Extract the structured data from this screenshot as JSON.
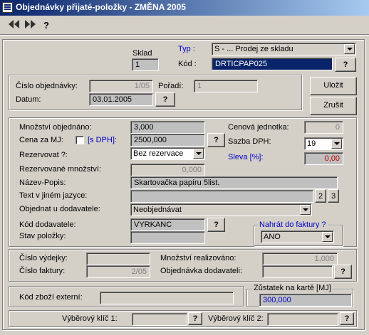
{
  "window": {
    "title": "Objednávky přijaté-položky - ZMĚNA 2005"
  },
  "toolbar": {
    "first_icon": "rewind-icon",
    "last_icon": "fast-forward-icon",
    "help_label": "?"
  },
  "top": {
    "sklad_label": "Sklad",
    "sklad_value": "1",
    "typ_label": "Typ :",
    "typ_value": "S - ...   Prodej ze skladu",
    "kod_label": "Kód :",
    "kod_value": "DRTICPAP025",
    "help": "?"
  },
  "order": {
    "cislo_label": "Číslo objednávky:",
    "cislo_value": "1/05",
    "poradi_label": "Pořadí:",
    "poradi_value": "1",
    "datum_label": "Datum:",
    "datum_value": "03.01.2005",
    "help": "?"
  },
  "actions": {
    "save": "Uložit",
    "cancel": "Zrušit"
  },
  "item": {
    "mnozstvi_label": "Množství objednáno:",
    "mnozstvi_value": "3,000",
    "cena_label": "Cena za MJ:",
    "sdph_label": "[s DPH]:",
    "cena_value": "2500,000",
    "rezervovat_label": "Rezervovat ?:",
    "rezervovat_value": "Bez rezervace",
    "rez_mnozstvi_label": "Rezervované množství:",
    "rez_mnozstvi_value": "0,000",
    "nazev_label": "Název-Popis:",
    "nazev_value": "Skartovačka papíru 5list.",
    "text_label": "Text v jiném jazyce:",
    "text_value": "",
    "lang2": "2",
    "lang3": "3",
    "objednat_label": "Objednat u dodavatele:",
    "objednat_value": "Neobjednávat",
    "kod_dod_label": "Kód dodavatele:",
    "kod_dod_value": "VYRKANC",
    "stav_label": "Stav položky:",
    "stav_value": "",
    "cenova_label": "Cenová jednotka:",
    "cenova_value": "0",
    "sazba_label": "Sazba DPH:",
    "sazba_value": "19",
    "sleva_label": "Sleva [%]:",
    "sleva_value": "0,00",
    "nahrat_label": "Nahrát do faktury ?",
    "nahrat_value": "ANO",
    "help": "?"
  },
  "realization": {
    "vydejka_label": "Číslo výdejky:",
    "vydejka_value": "",
    "faktura_label": "Číslo faktury:",
    "faktura_value": "2/05",
    "mnozstvi_label": "Množství realizováno:",
    "mnozstvi_value": "1,000",
    "obj_dod_label": "Objednávka dodavateli:",
    "obj_dod_value": "",
    "help": "?"
  },
  "external": {
    "kod_ext_label": "Kód zboží externí:",
    "kod_ext_value": "",
    "zustatek_label": "Zůstatek na kartě [MJ]",
    "zustatek_value": "300,000"
  },
  "keys": {
    "klic1_label": "Výběrový klíč 1:",
    "klic1_value": "",
    "klic2_label": "Výběrový klíč 2:",
    "klic2_value": "",
    "help": "?"
  },
  "colors": {
    "accent_blue": "#0000c8",
    "discount_red": "#c00000",
    "title_bar": "#0a246a"
  }
}
